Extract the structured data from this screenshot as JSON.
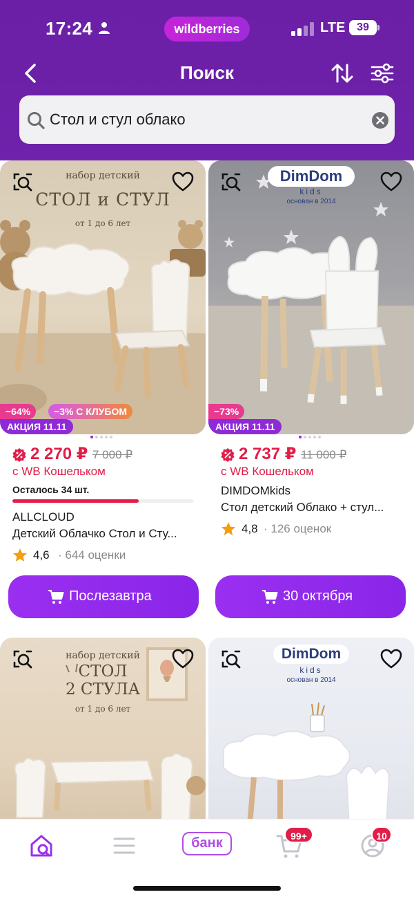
{
  "status_bar": {
    "time": "17:24",
    "brand": "wildberries",
    "network": "LTE",
    "battery": "39"
  },
  "nav": {
    "title": "Поиск"
  },
  "search": {
    "value": "Стол и стул облако"
  },
  "products": [
    {
      "overlay_subtitle": "набор детский",
      "overlay_title": "СТОЛ и СТУЛ",
      "overlay_age": "от 1 до 6 лет",
      "discount": "−64%",
      "club_discount": "−3% С КЛУБОМ",
      "promo": "АКЦИЯ 11.11",
      "price": "2 270 ₽",
      "old_price": "7 000 ₽",
      "wallet": "с WB Кошельком",
      "stock": "Осталось 34 шт.",
      "stock_fraction": 0.7,
      "brand": "ALLCLOUD",
      "name": "Детский Облачко Стол и Сту...",
      "rating": "4,6",
      "reviews": "· 644 оценки",
      "delivery": "Послезавтра"
    },
    {
      "overlay_logo": "DimDom",
      "overlay_logo_sub": "kids",
      "overlay_founded": "основан в 2014",
      "discount": "−73%",
      "promo": "АКЦИЯ 11.11",
      "price": "2 737 ₽",
      "old_price": "11 000 ₽",
      "wallet": "с WB Кошельком",
      "brand": "DIMDOMkids",
      "name": "Стол детский Облако + стул...",
      "rating": "4,8",
      "reviews": "· 126 оценок",
      "delivery": "30 октября"
    },
    {
      "overlay_subtitle": "набор детский",
      "overlay_title_1": "СТОЛ",
      "overlay_title_2": "2 СТУЛА",
      "overlay_age": "от 1 до 6 лет"
    },
    {
      "overlay_logo": "DimDom",
      "overlay_logo_sub": "kids",
      "overlay_founded": "основан в 2014"
    }
  ],
  "tabbar": {
    "bank_label": "банк",
    "cart_badge": "99+",
    "profile_badge": "10"
  },
  "colors": {
    "header": "#6b21a8",
    "accent": "#9b2ff0",
    "price": "#e11d48"
  }
}
